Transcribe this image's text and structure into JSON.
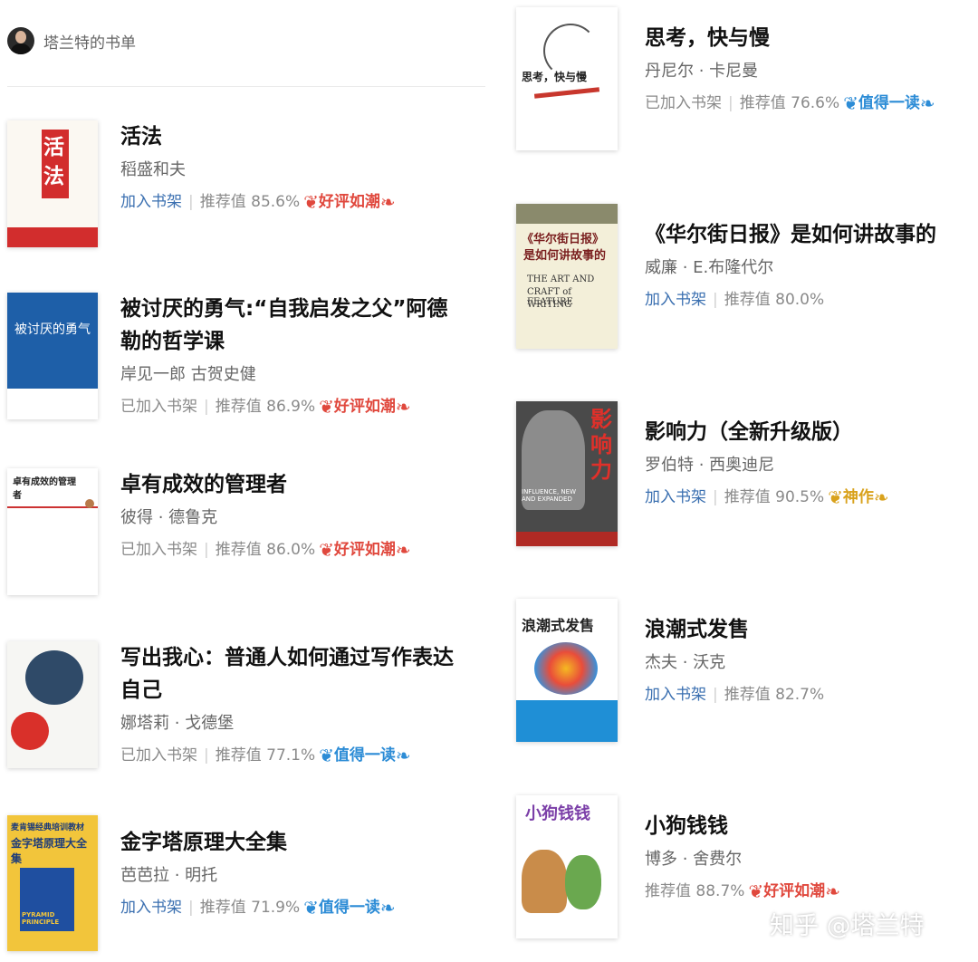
{
  "header": {
    "title": "塔兰特的书单"
  },
  "labels": {
    "recommend_prefix": "推荐值"
  },
  "books": [
    {
      "title": "活法",
      "author": "稻盛和夫",
      "shelf": "加入书架",
      "score": "85.6%",
      "badge": "好评如潮",
      "badge_color": "red",
      "cover_icon": "cover-huofa"
    },
    {
      "title": "被讨厌的勇气:“自我启发之父”阿德勒的哲学课",
      "author": "岸见一郎 古贺史健",
      "shelf": "已加入书架",
      "score": "86.9%",
      "badge": "好评如潮",
      "badge_color": "red",
      "cover_icon": "cover-courage"
    },
    {
      "title": "卓有成效的管理者",
      "author": "彼得 · 德鲁克",
      "shelf": "已加入书架",
      "score": "86.0%",
      "badge": "好评如潮",
      "badge_color": "red",
      "cover_icon": "cover-executive"
    },
    {
      "title": "写出我心：普通人如何通过写作表达自己",
      "author": "娜塔莉 · 戈德堡",
      "shelf": "已加入书架",
      "score": "77.1%",
      "badge": "值得一读",
      "badge_color": "blue",
      "cover_icon": "cover-writing"
    },
    {
      "title": "金字塔原理大全集",
      "author": "芭芭拉 · 明托",
      "shelf": "加入书架",
      "score": "71.9%",
      "badge": "值得一读",
      "badge_color": "blue",
      "cover_icon": "cover-pyramid"
    },
    {
      "title": "思考，快与慢",
      "author": "丹尼尔 · 卡尼曼",
      "shelf": "已加入书架",
      "score": "76.6%",
      "badge": "值得一读",
      "badge_color": "blue",
      "cover_icon": "cover-thinking"
    },
    {
      "title": "《华尔街日报》是如何讲故事的",
      "author": "威廉 · E.布隆代尔",
      "shelf": "加入书架",
      "score": "80.0%",
      "badge": "",
      "badge_color": "",
      "cover_icon": "cover-wsj"
    },
    {
      "title": "影响力（全新升级版）",
      "author": "罗伯特 · 西奥迪尼",
      "shelf": "加入书架",
      "score": "90.5%",
      "badge": "神作",
      "badge_color": "gold",
      "cover_icon": "cover-influence"
    },
    {
      "title": "浪潮式发售",
      "author": "杰夫 · 沃克",
      "shelf": "加入书架",
      "score": "82.7%",
      "badge": "",
      "badge_color": "",
      "cover_icon": "cover-launch"
    },
    {
      "title": "小狗钱钱",
      "author": "博多 · 舍费尔",
      "shelf": "",
      "score": "88.7%",
      "badge": "好评如潮",
      "badge_color": "red",
      "cover_icon": "cover-puppy"
    }
  ],
  "covers": {
    "huofa": {
      "text": "活法"
    },
    "courage": {
      "text": "被讨厌的勇气"
    },
    "executive": {
      "text": "卓有成效的管理者"
    },
    "thinking": {
      "text": "思考，快与慢"
    },
    "wsj": {
      "line1": "《华尔街日报》",
      "line2": "是如何讲故事的",
      "en1": "THE ART AND",
      "en2": "CRAFT of FEATURE",
      "en3": "WRITING"
    },
    "influence": {
      "text": "影响力",
      "en": "INFLUENCE, NEW AND EXPANDED"
    },
    "launch": {
      "text": "浪潮式发售"
    },
    "pyramid": {
      "top": "麦肯锡经典培训教材",
      "main": "金字塔原理大全集",
      "en": "PYRAMID PRINCIPLE"
    },
    "puppy": {
      "text": "小狗钱钱"
    }
  },
  "watermark": "知乎 @塔兰特"
}
